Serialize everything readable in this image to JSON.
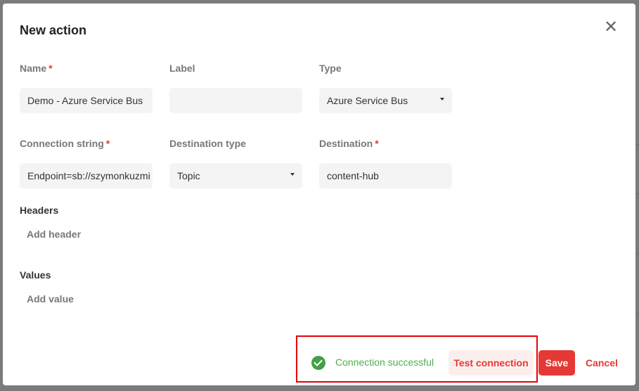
{
  "dialog": {
    "title": "New action"
  },
  "fields": {
    "name": {
      "label": "Name",
      "value": "Demo - Azure Service Bus"
    },
    "label": {
      "label": "Label",
      "value": ""
    },
    "type": {
      "label": "Type",
      "value": "Azure Service Bus"
    },
    "connection_string": {
      "label": "Connection string",
      "value": "Endpoint=sb://szymonkuzmi"
    },
    "destination_type": {
      "label": "Destination type",
      "value": "Topic"
    },
    "destination": {
      "label": "Destination",
      "value": "content-hub"
    }
  },
  "required_mark": "*",
  "headers": {
    "title": "Headers",
    "add": "Add header"
  },
  "values": {
    "title": "Values",
    "add": "Add value"
  },
  "footer": {
    "status": "Connection successful",
    "test": "Test connection",
    "save": "Save",
    "cancel": "Cancel"
  },
  "colors": {
    "accent": "#e53935",
    "success": "#43a047",
    "highlight": "#e8000b"
  }
}
